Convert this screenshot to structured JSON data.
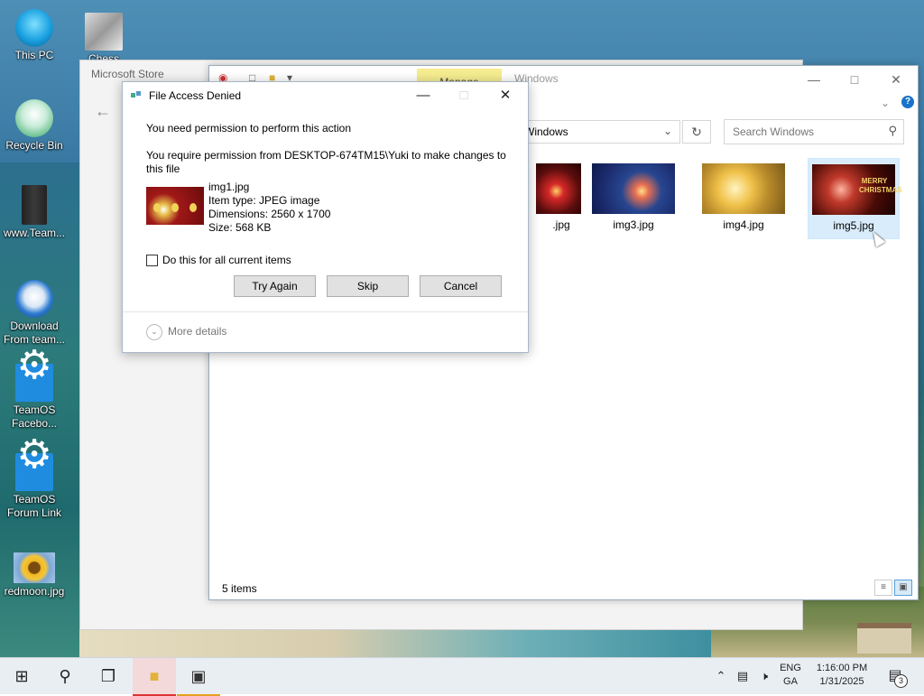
{
  "desktop": {
    "icons": [
      {
        "label": "This PC"
      },
      {
        "label": "Chess"
      },
      {
        "label": "Recycle Bin"
      },
      {
        "label": "www.Team..."
      },
      {
        "label": "Download From team..."
      },
      {
        "label": "TeamOS Facebo..."
      },
      {
        "label": "TeamOS Forum Link"
      },
      {
        "label": "redmoon.jpg"
      }
    ]
  },
  "store": {
    "title": "Microsoft Store",
    "back_icon": "back-arrow-icon"
  },
  "explorer": {
    "manage_tab": "Manage",
    "title": "Windows",
    "address": "Windows",
    "search_placeholder": "Search Windows",
    "files": [
      {
        "name": ".jpg"
      },
      {
        "name": "img3.jpg"
      },
      {
        "name": "img4.jpg"
      },
      {
        "name": "img5.jpg",
        "thumb_text": "MERRY CHRISTMAS"
      }
    ],
    "status": "5 items"
  },
  "dialog": {
    "title": "File Access Denied",
    "message": "You need permission to perform this action",
    "detail": "You require permission from DESKTOP-674TM15\\Yuki to make changes to this file",
    "file": {
      "name": "img1.jpg",
      "type": "Item type: JPEG image",
      "dimensions": "Dimensions: 2560 x 1700",
      "size": "Size: 568 KB"
    },
    "checkbox_label": "Do this for all current items",
    "buttons": {
      "try_again": "Try Again",
      "skip": "Skip",
      "cancel": "Cancel"
    },
    "more_details": "More details"
  },
  "taskbar": {
    "lang_top": "ENG",
    "lang_bottom": "GA",
    "time": "1:16:00 PM",
    "date": "1/31/2025",
    "notification_count": "3"
  }
}
